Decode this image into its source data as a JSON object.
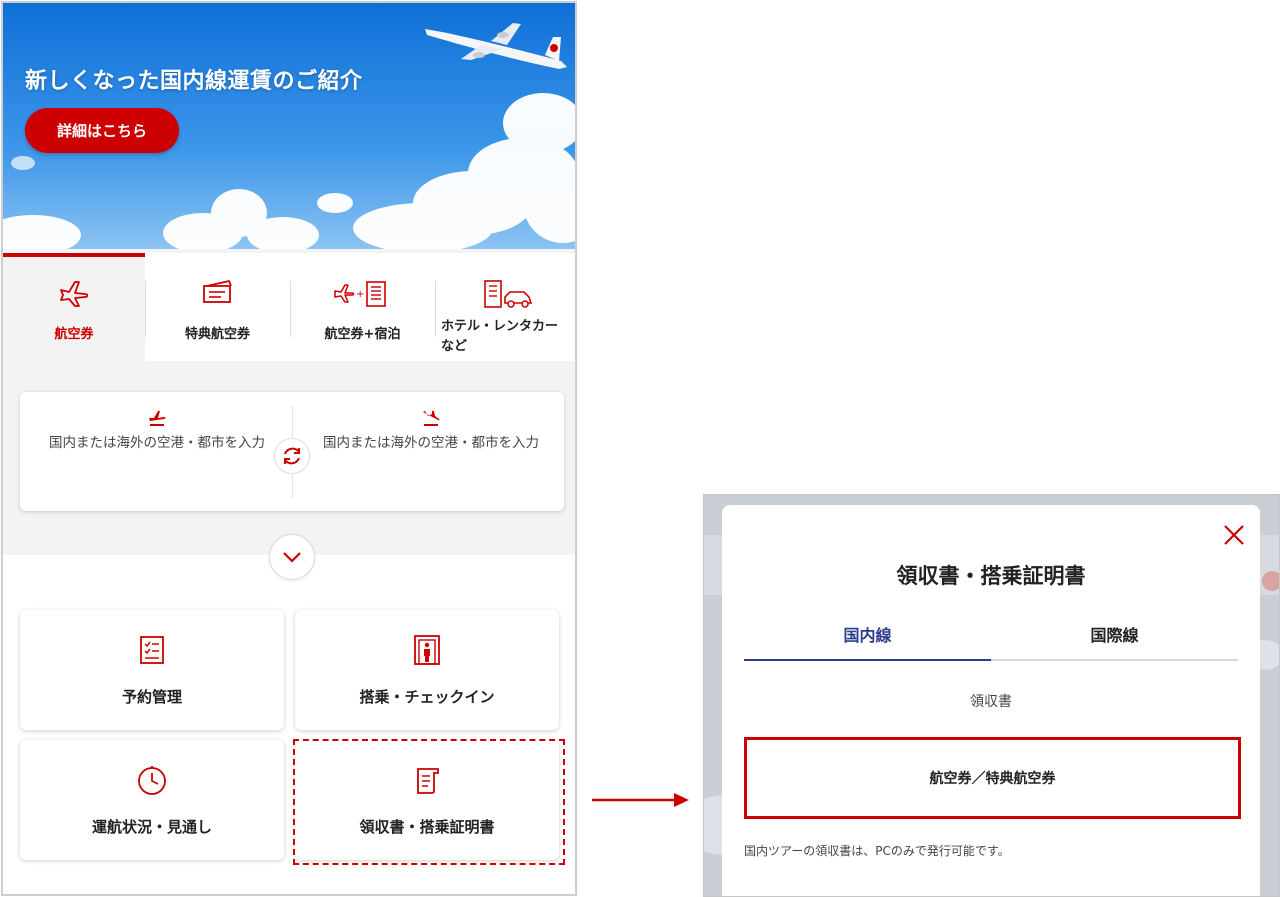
{
  "hero": {
    "title": "新しくなった国内線運賃のご紹介",
    "button_label": "詳細はこちら"
  },
  "tabs": [
    {
      "label": "航空券",
      "icon": "airplane-icon",
      "active": true
    },
    {
      "label": "特典航空券",
      "icon": "award-ticket-icon",
      "active": false
    },
    {
      "label": "航空券+宿泊",
      "icon": "airplane-hotel-icon",
      "active": false
    },
    {
      "label_line1": "ホテル・レンタカー",
      "label_line2": "など",
      "icon": "hotel-car-icon",
      "active": false
    }
  ],
  "route": {
    "origin_placeholder": "国内または海外の空港・都市を入力",
    "destination_placeholder": "国内または海外の空港・都市を入力"
  },
  "menu": [
    {
      "label": "予約管理",
      "icon": "checklist-icon"
    },
    {
      "label": "搭乗・チェックイン",
      "icon": "boarding-gate-icon"
    },
    {
      "label": "運航状況・見通し",
      "icon": "clock-icon"
    },
    {
      "label": "領収書・搭乗証明書",
      "icon": "receipt-icon"
    }
  ],
  "modal": {
    "title": "領収書・搭乗証明書",
    "tabs": [
      {
        "label": "国内線",
        "active": true
      },
      {
        "label": "国際線",
        "active": false
      }
    ],
    "section_label": "領収書",
    "ticket_button": "航空券／特典航空券",
    "note": "国内ツアーの領収書は、PCのみで発行可能です。"
  },
  "colors": {
    "brand_red": "#cc0000",
    "tab_blue": "#2b3c8e"
  }
}
